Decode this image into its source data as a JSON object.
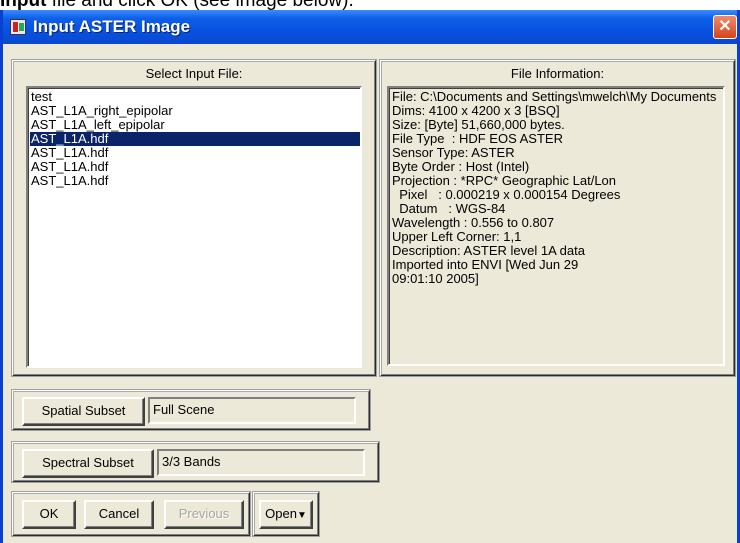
{
  "page_caption": {
    "bold_part": "Input",
    "rest": " file and click OK (see image below)."
  },
  "window": {
    "title": "Input ASTER Image",
    "close_glyph": "✕"
  },
  "select_panel": {
    "heading": "Select Input File:",
    "files": [
      {
        "label": "test",
        "selected": false
      },
      {
        "label": "AST_L1A_right_epipolar",
        "selected": false
      },
      {
        "label": "AST_L1A_left_epipolar",
        "selected": false
      },
      {
        "label": "AST_L1A.hdf",
        "selected": true
      },
      {
        "label": "AST_L1A.hdf",
        "selected": false
      },
      {
        "label": "AST_L1A.hdf",
        "selected": false
      },
      {
        "label": "AST_L1A.hdf",
        "selected": false
      }
    ]
  },
  "info_panel": {
    "heading": "File Information:",
    "lines": [
      "File: C:\\Documents and Settings\\mwelch\\My Documents",
      "Dims: 4100 x 4200 x 3 [BSQ]",
      "Size: [Byte] 51,660,000 bytes.",
      "File Type  : HDF EOS ASTER",
      "Sensor Type: ASTER",
      "Byte Order : Host (Intel)",
      "Projection : *RPC* Geographic Lat/Lon",
      "  Pixel   : 0.000219 x 0.000154 Degrees",
      "  Datum   : WGS-84",
      "Wavelength : 0.556 to 0.807",
      "Upper Left Corner: 1,1",
      "Description: ASTER level 1A data",
      "Imported into ENVI [Wed Jun 29",
      "09:01:10 2005]"
    ]
  },
  "spatial_subset": {
    "button_label": "Spatial Subset",
    "value": "Full Scene"
  },
  "spectral_subset": {
    "button_label": "Spectral Subset",
    "value": "3/3 Bands"
  },
  "buttons": {
    "ok": "OK",
    "cancel": "Cancel",
    "previous": "Previous",
    "open": "Open",
    "open_arrow": "▼"
  }
}
